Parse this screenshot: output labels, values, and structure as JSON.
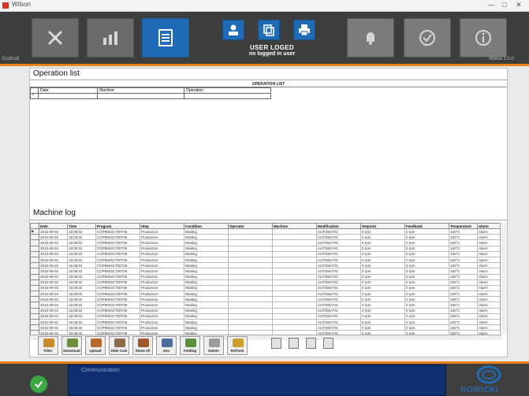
{
  "window": {
    "title": "Wilson",
    "controls": [
      "—",
      "□",
      "✕"
    ]
  },
  "toolbar": {
    "user_status_line1": "USER LOGED",
    "user_status_line2": "no logged in user",
    "left_label": "Ecdfcs8",
    "right_label": "Atlasa 1.0.0"
  },
  "operation_list": {
    "title": "Operation list",
    "header": "OPERATION LIST",
    "columns": [
      "Date",
      "Machine",
      "Operation"
    ]
  },
  "machine_log": {
    "title": "Machine  log",
    "columns": [
      "Date",
      "Time",
      "Program",
      "Step",
      "Condition",
      "Operator",
      "Machine",
      "Modification",
      "Setpoint",
      "Feedback",
      "Temperature",
      "Alarm"
    ],
    "rows": [
      [
        "2015-09-02",
        "15:08:02",
        "COP9604C700T06",
        "Production",
        "Waiting",
        "",
        "",
        "AUTOMATIC",
        "0 rpm",
        "0 rpm",
        "160°C",
        "Alarm"
      ],
      [
        "2015-09-02",
        "15:08:02",
        "COP9604C700T06",
        "Production",
        "Waiting",
        "",
        "",
        "AUTOMATIC",
        "0 rpm",
        "0 rpm",
        "160°C",
        "Alarm"
      ],
      [
        "2015-09-02",
        "15:08:02",
        "COP9604C700T06",
        "Production",
        "Waiting",
        "",
        "",
        "AUTOMATIC",
        "0 rpm",
        "0 rpm",
        "160°C",
        "Alarm"
      ],
      [
        "2015-09-02",
        "15:08:02",
        "COP9604C700T06",
        "Production",
        "Waiting",
        "",
        "",
        "AUTOMATIC",
        "0 rpm",
        "0 rpm",
        "160°C",
        "Alarm"
      ],
      [
        "2015-09-02",
        "15:08:02",
        "COP9604C700T06",
        "Production",
        "Waiting",
        "",
        "",
        "AUTOMATIC",
        "0 rpm",
        "0 rpm",
        "160°C",
        "Alarm"
      ],
      [
        "2015-09-02",
        "15:08:02",
        "COP9604C700T06",
        "Production",
        "Waiting",
        "",
        "",
        "AUTOMATIC",
        "0 rpm",
        "0 rpm",
        "160°C",
        "Alarm"
      ],
      [
        "2015-09-02",
        "15:08:02",
        "COP9604C700T06",
        "Production",
        "Waiting",
        "",
        "",
        "AUTOMATIC",
        "0 rpm",
        "0 rpm",
        "160°C",
        "Alarm"
      ],
      [
        "2015-09-02",
        "15:08:02",
        "COP9604C700T06",
        "Production",
        "Waiting",
        "",
        "",
        "AUTOMATIC",
        "0 rpm",
        "0 rpm",
        "160°C",
        "Alarm"
      ],
      [
        "2015-09-02",
        "15:08:02",
        "COP9604C700T06",
        "Production",
        "Waiting",
        "",
        "",
        "AUTOMATIC",
        "0 rpm",
        "0 rpm",
        "160°C",
        "Alarm"
      ],
      [
        "2015-09-02",
        "15:08:02",
        "COP9604C700T06",
        "Production",
        "Waiting",
        "",
        "",
        "AUTOMATIC",
        "0 rpm",
        "0 rpm",
        "160°C",
        "Alarm"
      ],
      [
        "2015-09-02",
        "15:08:02",
        "COP9604C700T06",
        "Production",
        "Waiting",
        "",
        "",
        "AUTOMATIC",
        "0 rpm",
        "0 rpm",
        "160°C",
        "Alarm"
      ],
      [
        "2015-09-02",
        "15:08:02",
        "COP9604C700T06",
        "Production",
        "Waiting",
        "",
        "",
        "AUTOMATIC",
        "0 rpm",
        "0 rpm",
        "160°C",
        "Alarm"
      ],
      [
        "2015-09-02",
        "15:08:02",
        "COP9604C700T06",
        "Production",
        "Waiting",
        "",
        "",
        "AUTOMATIC",
        "0 rpm",
        "0 rpm",
        "160°C",
        "Alarm"
      ],
      [
        "2015-09-02",
        "15:08:02",
        "COP9604C700T06",
        "Production",
        "Waiting",
        "",
        "",
        "AUTOMATIC",
        "0 rpm",
        "0 rpm",
        "160°C",
        "Alarm"
      ],
      [
        "2015-09-02",
        "15:08:02",
        "COP9604C700T06",
        "Production",
        "Waiting",
        "",
        "",
        "AUTOMATIC",
        "0 rpm",
        "0 rpm",
        "160°C",
        "Alarm"
      ],
      [
        "2015-09-02",
        "15:08:02",
        "COP9604C700T06",
        "Production",
        "Waiting",
        "",
        "",
        "AUTOMATIC",
        "0 rpm",
        "0 rpm",
        "160°C",
        "Alarm"
      ],
      [
        "2015-09-02",
        "15:08:02",
        "COP9604C700T06",
        "Production",
        "Waiting",
        "",
        "",
        "AUTOMATIC",
        "0 rpm",
        "0 rpm",
        "160°C",
        "Alarm"
      ],
      [
        "2015-09-02",
        "15:08:02",
        "COP9604C700T06",
        "Production",
        "Waiting",
        "",
        "",
        "AUTOMATIC",
        "0 rpm",
        "0 rpm",
        "160°C",
        "Alarm"
      ],
      [
        "2015-09-02",
        "15:08:02",
        "COP9604C700T06",
        "Production",
        "Waiting",
        "",
        "",
        "AUTOMATIC",
        "0 rpm",
        "0 rpm",
        "160°C",
        "Alarm"
      ]
    ]
  },
  "tools": [
    {
      "label": "Filter",
      "icon": "filter-icon"
    },
    {
      "label": "Download",
      "icon": "download-icon"
    },
    {
      "label": "Upload",
      "icon": "upload-icon"
    },
    {
      "label": "Hide Cols",
      "icon": "hide-columns-icon"
    },
    {
      "label": "Show All",
      "icon": "show-all-icon"
    },
    {
      "label": "Zoo",
      "icon": "zoom-icon"
    },
    {
      "label": "Folding",
      "icon": "folding-icon"
    },
    {
      "label": "Delete",
      "icon": "delete-icon"
    },
    {
      "label": "Refresh",
      "icon": "refresh-icon"
    }
  ],
  "status": {
    "title": "Communication",
    "brand": "NOWICKI"
  },
  "colors": {
    "accent_blue": "#1f6bb5",
    "accent_orange": "#e8811d",
    "status_green": "#3aa843",
    "message_bg": "#0e2e70"
  }
}
